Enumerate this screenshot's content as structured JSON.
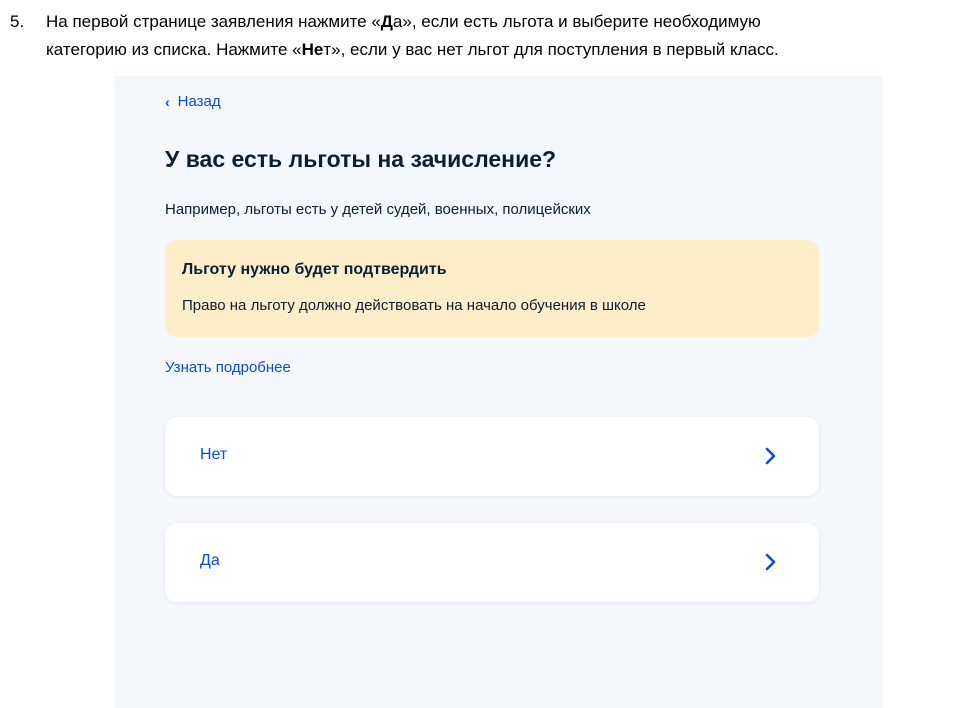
{
  "instruction": {
    "number": "5.",
    "line1_before": "На первой странице заявления нажмите «",
    "line1_bold": "Д",
    "line1_after": "а», если есть  льгота и выберите необходимую",
    "line2_before": "категорию из списка. Нажмите «",
    "line2_bold": "Не",
    "line2_after": "т», если у вас нет льгот для поступления в первый класс."
  },
  "screen": {
    "back_label": "Назад",
    "back_icon": "chevron-left-icon",
    "title": "У вас есть льготы на зачисление?",
    "hint": "Например, льготы есть у детей судей, военных, полицейских",
    "notice": {
      "title": "Льготу нужно будет подтвердить",
      "text": "Право на льготу должно действовать на начало обучения в школе",
      "background": "#fdedc9"
    },
    "more_link": "Узнать подробнее",
    "options": [
      {
        "label": "Нет",
        "icon": "chevron-right-icon"
      },
      {
        "label": "Да",
        "icon": "chevron-right-icon"
      }
    ]
  },
  "colors": {
    "accent": "#0d4cd3",
    "panel_background": "#f4f7fc",
    "text": "#0b1f33"
  }
}
